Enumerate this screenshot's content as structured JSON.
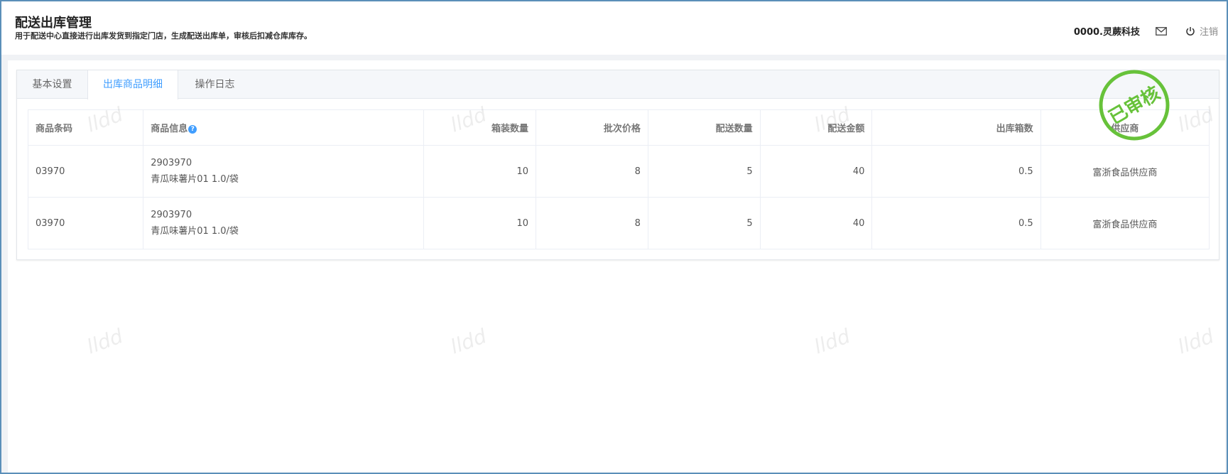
{
  "header": {
    "title": "配送出库管理",
    "subtitle": "用于配送中心直接进行出库发货到指定门店，生成配送出库单，审核后扣减仓库库存。",
    "company": "0000.灵蕨科技",
    "logout_label": "注销"
  },
  "tabs": [
    {
      "label": "基本设置"
    },
    {
      "label": "出库商品明细"
    },
    {
      "label": "操作日志"
    }
  ],
  "active_tab": "出库商品明细",
  "table": {
    "columns": [
      "商品条码",
      "商品信息",
      "箱装数量",
      "批次价格",
      "配送数量",
      "配送金额",
      "出库箱数",
      "供应商"
    ],
    "rows": [
      {
        "barcode": "03970",
        "code": "2903970",
        "name": "青瓜味薯片01 1.0/袋",
        "box_qty": "10",
        "price": "8",
        "qty": "5",
        "amount": "40",
        "boxes": "0.5",
        "supplier": "富浙食品供应商"
      },
      {
        "barcode": "03970",
        "code": "2903970",
        "name": "青瓜味薯片01 1.0/袋",
        "box_qty": "10",
        "price": "8",
        "qty": "5",
        "amount": "40",
        "boxes": "0.5",
        "supplier": "富浙食品供应商"
      }
    ]
  },
  "stamp": {
    "text": "已审核",
    "color": "#67c23a"
  },
  "watermark": "lldd",
  "icons": {
    "mail": "mail-icon",
    "power": "power-icon",
    "help": "help-icon"
  }
}
